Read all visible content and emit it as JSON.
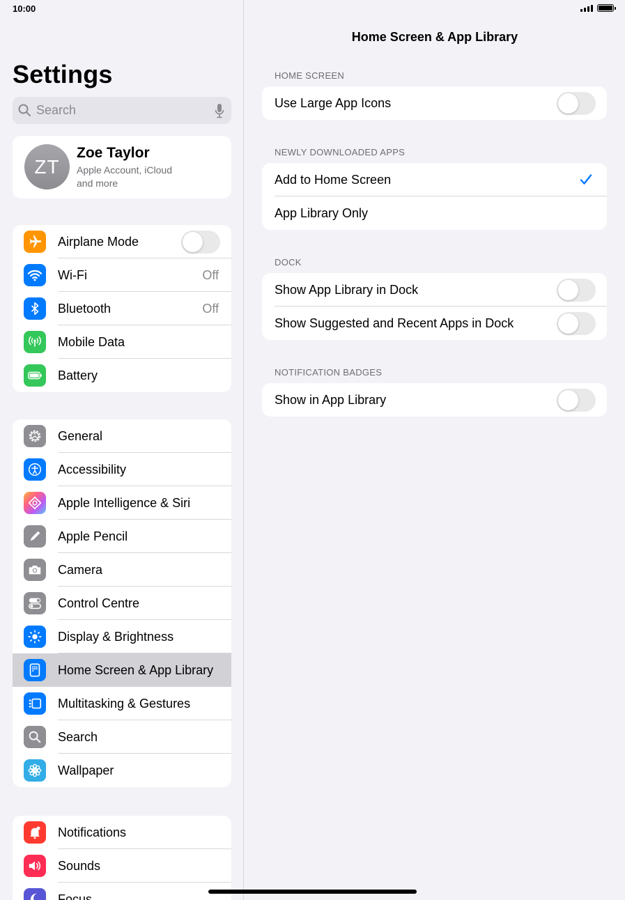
{
  "status_bar": {
    "time": "10:00"
  },
  "sidebar": {
    "title": "Settings",
    "search": {
      "placeholder": "Search"
    },
    "profile": {
      "initials": "ZT",
      "name": "Zoe Taylor",
      "subtitle_line1": "Apple Account, iCloud",
      "subtitle_line2": "and more"
    },
    "group1": [
      {
        "label": "Airplane Mode",
        "icon": "airplane-icon",
        "color": "#ff9500",
        "toggle": false
      },
      {
        "label": "Wi-Fi",
        "icon": "wifi-icon",
        "color": "#007aff",
        "value": "Off"
      },
      {
        "label": "Bluetooth",
        "icon": "bluetooth-icon",
        "color": "#007aff",
        "value": "Off"
      },
      {
        "label": "Mobile Data",
        "icon": "antenna-icon",
        "color": "#34c759"
      },
      {
        "label": "Battery",
        "icon": "battery-icon",
        "color": "#34c759"
      }
    ],
    "group2": [
      {
        "label": "General",
        "icon": "gear-icon",
        "color": "#8e8e93"
      },
      {
        "label": "Accessibility",
        "icon": "accessibility-icon",
        "color": "#007aff"
      },
      {
        "label": "Apple Intelligence & Siri",
        "icon": "siri-icon",
        "color": "#ff6482"
      },
      {
        "label": "Apple Pencil",
        "icon": "pencil-icon",
        "color": "#8e8e93"
      },
      {
        "label": "Camera",
        "icon": "camera-icon",
        "color": "#8e8e93"
      },
      {
        "label": "Control Centre",
        "icon": "switches-icon",
        "color": "#8e8e93"
      },
      {
        "label": "Display & Brightness",
        "icon": "sun-icon",
        "color": "#007aff"
      },
      {
        "label": "Home Screen & App Library",
        "icon": "home-screen-icon",
        "color": "#007aff",
        "selected": true
      },
      {
        "label": "Multitasking & Gestures",
        "icon": "multitasking-icon",
        "color": "#007aff"
      },
      {
        "label": "Search",
        "icon": "search-icon",
        "color": "#8e8e93"
      },
      {
        "label": "Wallpaper",
        "icon": "flower-icon",
        "color": "#32ade6"
      }
    ],
    "group3": [
      {
        "label": "Notifications",
        "icon": "bell-icon",
        "color": "#ff3b30"
      },
      {
        "label": "Sounds",
        "icon": "speaker-icon",
        "color": "#ff2d55"
      },
      {
        "label": "Focus",
        "icon": "moon-icon",
        "color": "#5856d6"
      }
    ]
  },
  "detail": {
    "title": "Home Screen & App Library",
    "sections": {
      "home_screen": {
        "header": "HOME SCREEN",
        "rows": [
          {
            "label": "Use Large App Icons",
            "toggle": false
          }
        ]
      },
      "newly_downloaded": {
        "header": "NEWLY DOWNLOADED APPS",
        "rows": [
          {
            "label": "Add to Home Screen",
            "checked": true
          },
          {
            "label": "App Library Only",
            "checked": false
          }
        ]
      },
      "dock": {
        "header": "DOCK",
        "rows": [
          {
            "label": "Show App Library in Dock",
            "toggle": false
          },
          {
            "label": "Show Suggested and Recent Apps in Dock",
            "toggle": false
          }
        ]
      },
      "badges": {
        "header": "NOTIFICATION BADGES",
        "rows": [
          {
            "label": "Show in App Library",
            "toggle": false
          }
        ]
      }
    }
  },
  "colors": {
    "accent": "#007aff",
    "background": "#f2f2f7",
    "selected_row": "#d1d1d6"
  }
}
